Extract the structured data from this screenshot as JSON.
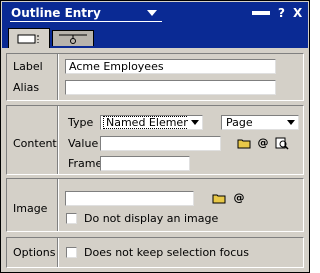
{
  "window": {
    "title": "Outline Entry",
    "help_glyph": "?",
    "close_glyph": "X"
  },
  "tabs": [
    {
      "icon": "outline-entry-basics-icon",
      "active": true
    },
    {
      "icon": "pushpin-icon",
      "active": false
    }
  ],
  "basics": {
    "label_caption": "Label",
    "label_value": "Acme Employees",
    "alias_caption": "Alias",
    "alias_value": ""
  },
  "content": {
    "section_caption": "Content",
    "type_caption": "Type",
    "type_value": "Named Element",
    "subtype_value": "Page",
    "value_caption": "Value",
    "value_value": "",
    "frame_caption": "Frame",
    "frame_value": "",
    "at_glyph": "@"
  },
  "image": {
    "section_caption": "Image",
    "image_value": "",
    "at_glyph": "@",
    "no_image_label": "Do not display an image",
    "no_image_checked": false
  },
  "options": {
    "section_caption": "Options",
    "keep_focus_label": "Does not keep selection focus",
    "keep_focus_checked": false
  },
  "colors": {
    "titlebar": "#0a2a94",
    "dialog_face": "#d4d0c8",
    "folder_icon": "#e8c848"
  }
}
